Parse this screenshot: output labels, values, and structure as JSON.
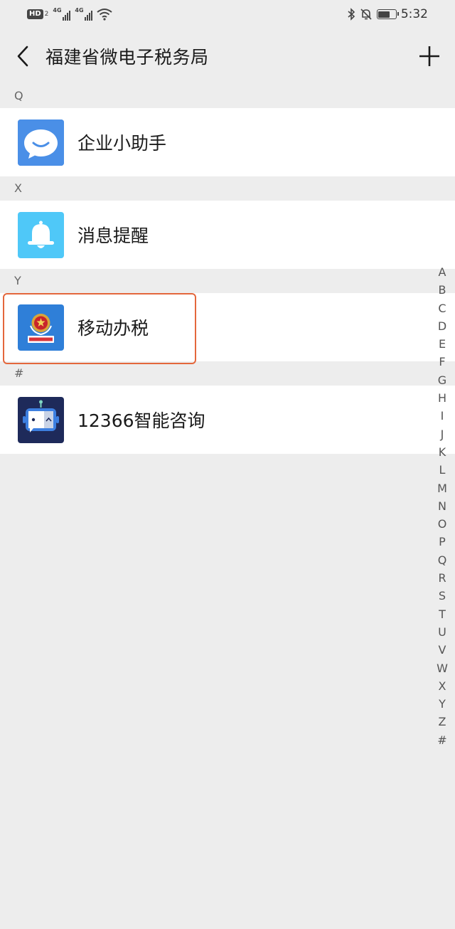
{
  "status_bar": {
    "hd_label": "HD",
    "sim_label": "2",
    "network_1": "4G",
    "network_2": "4G",
    "time": "5:32",
    "battery_level": 0.7
  },
  "header": {
    "title": "福建省微电子税务局"
  },
  "sections": [
    {
      "letter": "Q",
      "items": [
        {
          "label": "企业小助手",
          "icon": "chat-bubble-icon"
        }
      ]
    },
    {
      "letter": "X",
      "items": [
        {
          "label": "消息提醒",
          "icon": "bell-icon"
        }
      ]
    },
    {
      "letter": "Y",
      "items": [
        {
          "label": "移动办税",
          "icon": "tax-emblem-icon"
        }
      ]
    },
    {
      "letter": "#",
      "items": [
        {
          "label": "12366智能咨询",
          "icon": "robot-icon"
        }
      ]
    }
  ],
  "index_letters": [
    "A",
    "B",
    "C",
    "D",
    "E",
    "F",
    "G",
    "H",
    "I",
    "J",
    "K",
    "L",
    "M",
    "N",
    "O",
    "P",
    "Q",
    "R",
    "S",
    "T",
    "U",
    "V",
    "W",
    "X",
    "Y",
    "Z",
    "#"
  ],
  "colors": {
    "background": "#ededed",
    "highlight_border": "#e4673c",
    "chat_icon_bg": "#4a8fe7",
    "bell_icon_bg": "#4fc8f8",
    "tax_icon_bg": "#2f7fd8",
    "robot_icon_bg": "#1e2a5a"
  }
}
